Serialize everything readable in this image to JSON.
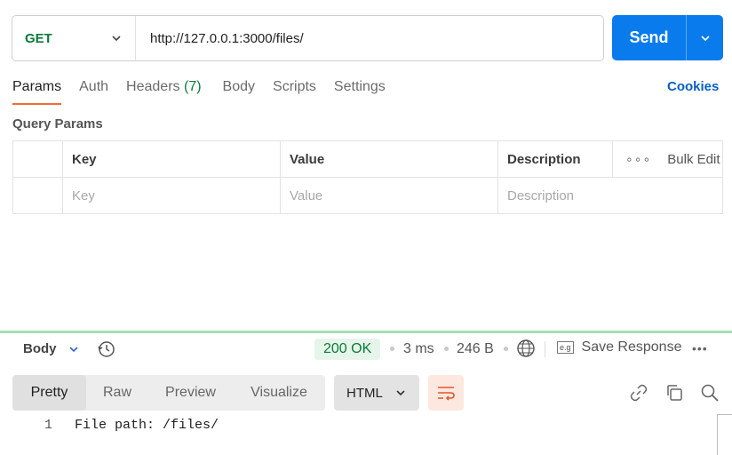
{
  "request": {
    "method": "GET",
    "url": "http://127.0.0.1:3000/files/",
    "send_label": "Send"
  },
  "tabs": [
    {
      "label": "Params",
      "active": true
    },
    {
      "label": "Auth"
    },
    {
      "label": "Headers",
      "count": "(7)"
    },
    {
      "label": "Body"
    },
    {
      "label": "Scripts"
    },
    {
      "label": "Settings"
    }
  ],
  "cookies_label": "Cookies",
  "query_params": {
    "title": "Query Params",
    "headers": {
      "key": "Key",
      "value": "Value",
      "description": "Description",
      "bulk_edit": "Bulk Edit"
    },
    "placeholders": {
      "key": "Key",
      "value": "Value",
      "description": "Description"
    }
  },
  "response": {
    "body_label": "Body",
    "status": "200 OK",
    "time": "3 ms",
    "size": "246 B",
    "save_label": "Save Response",
    "save_icon_text": "e.g",
    "more": "•••",
    "view_modes": [
      "Pretty",
      "Raw",
      "Preview",
      "Visualize"
    ],
    "active_view": "Pretty",
    "format": "HTML",
    "lines": [
      {
        "number": "1",
        "text": "File path: /files/"
      }
    ]
  },
  "colors": {
    "send_bg": "#097bed",
    "method_green": "#0b7a3b",
    "tab_underline": "#f26b3a",
    "cookies_blue": "#0a5fc4",
    "status_bg": "#e6f5ea",
    "divider": "#a7dfb6"
  },
  "icons": [
    "chevron-down-icon",
    "history-icon",
    "globe-icon",
    "more-icon",
    "wrap-lines-icon",
    "link-icon",
    "copy-icon",
    "search-icon"
  ]
}
